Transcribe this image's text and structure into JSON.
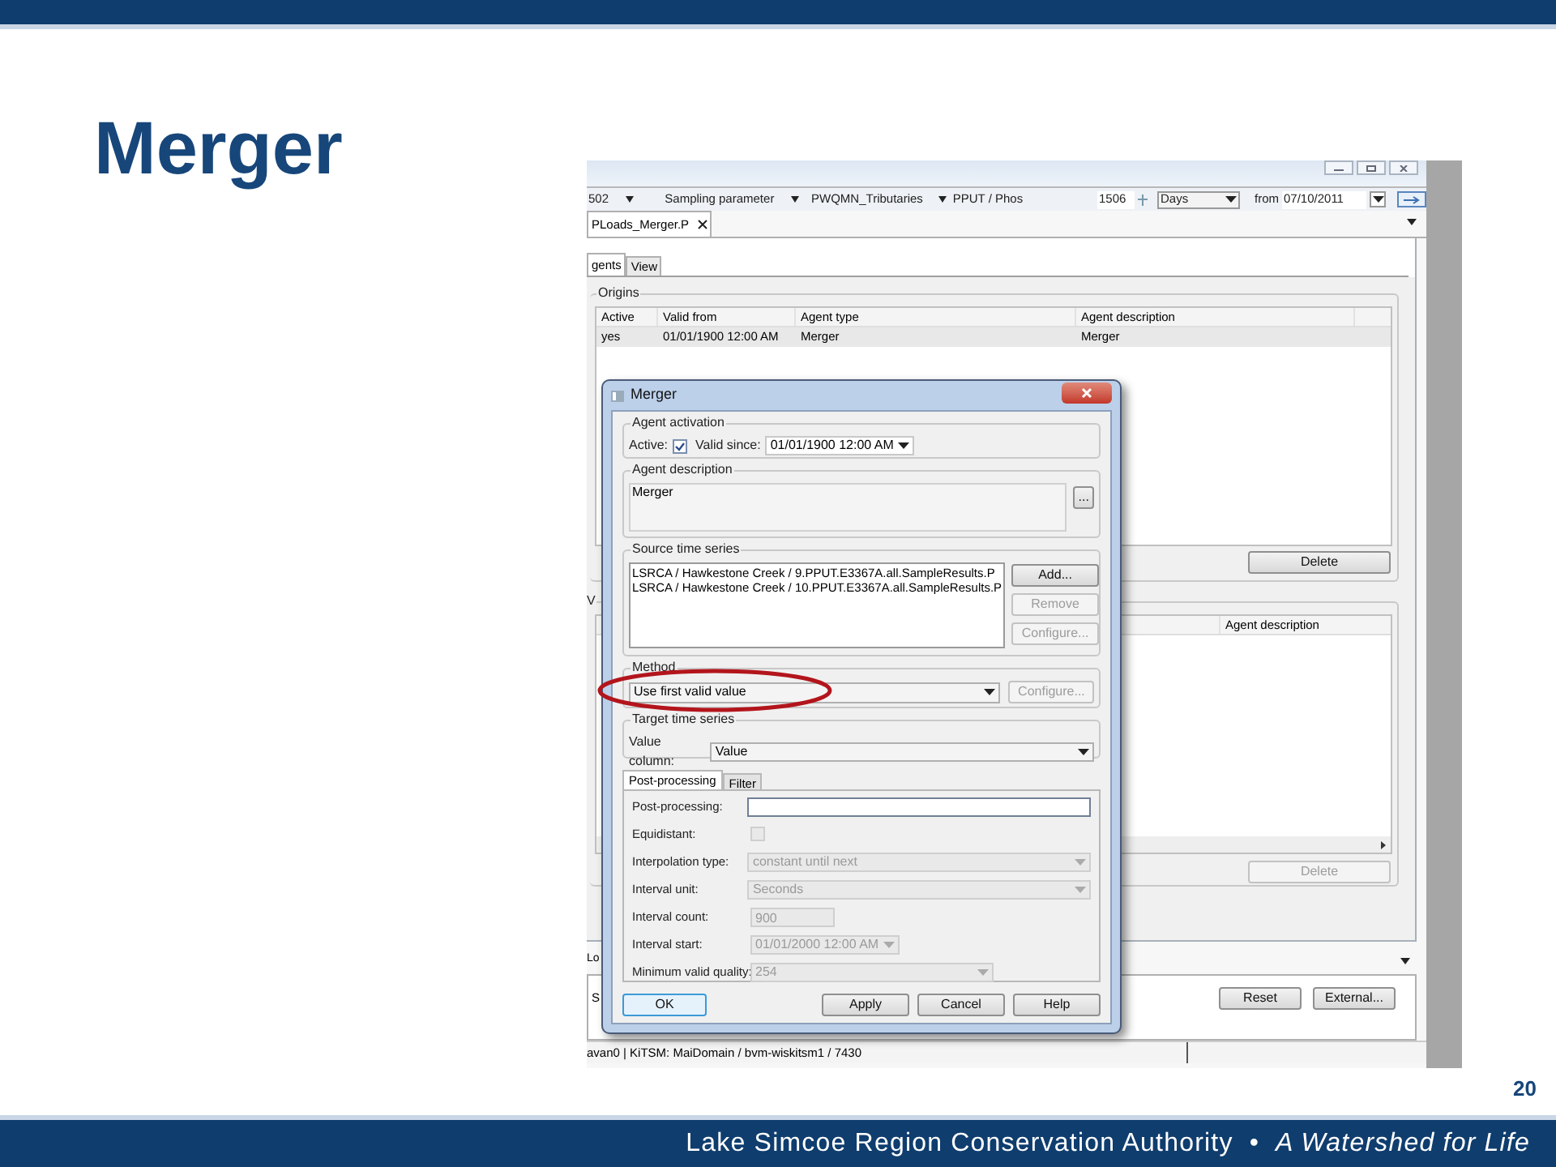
{
  "slide": {
    "title": "Merger",
    "page_number": "20",
    "footer": {
      "organization": "Lake Simcoe Region Conservation Authority",
      "separator": "•",
      "tagline": "A Watershed for Life"
    }
  },
  "app": {
    "toolbar": {
      "items": [
        {
          "label": "502",
          "dropdown": true
        },
        {
          "label": "Sampling parameter",
          "dropdown": true
        },
        {
          "label": "PWQMN_Tributaries",
          "dropdown": true
        },
        {
          "label": "PPUT / Phos",
          "dropdown": false
        }
      ],
      "count": "1506",
      "unit": "Days",
      "from_label": "from",
      "from_date": "07/10/2011"
    },
    "document_tab": {
      "label": "PLoads_Merger.P"
    },
    "subtabs": [
      {
        "label": "gents",
        "selected": true
      },
      {
        "label": "View",
        "selected": false
      }
    ],
    "origins": {
      "title": "Origins",
      "columns": [
        "Active",
        "Valid from",
        "Agent type",
        "Agent description"
      ],
      "rows": [
        {
          "cells": [
            "yes",
            "01/01/1900 12:00 AM",
            "Merger",
            "Merger"
          ],
          "selected": true
        }
      ],
      "delete_button": {
        "label": "Delete",
        "disabled": false
      }
    },
    "second_group": {
      "title": "V",
      "columns": [
        "Agent description"
      ],
      "delete_button": {
        "label": "Delete",
        "disabled": true
      }
    },
    "bottom": {
      "panel_label": "Lo",
      "side_label": "S",
      "buttons": [
        "Reset",
        "External..."
      ]
    },
    "status_bar": "avan0 | KiTSM: MaiDomain / bvm-wiskitsm1 / 7430"
  },
  "dialog": {
    "title": "Merger",
    "agent_activation": {
      "title": "Agent activation",
      "active_label": "Active:",
      "active_checked": true,
      "valid_since_label": "Valid since:",
      "valid_since": "01/01/1900 12:00 AM"
    },
    "agent_description": {
      "title": "Agent description",
      "value": "Merger",
      "more_button": "..."
    },
    "source": {
      "title": "Source time series",
      "items": [
        "LSRCA / Hawkestone Creek / 9.PPUT.E3367A.all.SampleResults.P",
        "LSRCA / Hawkestone Creek / 10.PPUT.E3367A.all.SampleResults.P"
      ],
      "buttons": [
        {
          "label": "Add...",
          "disabled": false
        },
        {
          "label": "Remove",
          "disabled": true
        },
        {
          "label": "Configure...",
          "disabled": true
        }
      ]
    },
    "method": {
      "title": "Method",
      "value": "Use first valid value",
      "configure": {
        "label": "Configure...",
        "disabled": true
      }
    },
    "target": {
      "title": "Target time series",
      "value_column_label": "Value column:",
      "value": "Value"
    },
    "tabs": [
      {
        "label": "Post-processing",
        "selected": true
      },
      {
        "label": "Filter",
        "selected": false
      }
    ],
    "fields": [
      {
        "label": "Post-processing:",
        "kind": "text",
        "disabled": false
      },
      {
        "label": "Equidistant:",
        "kind": "checkbox",
        "checked": false,
        "disabled": true
      },
      {
        "label": "Interpolation type:",
        "kind": "select",
        "value": "constant until next",
        "disabled": true
      },
      {
        "label": "Interval unit:",
        "kind": "select",
        "value": "Seconds",
        "disabled": true
      },
      {
        "label": "Interval count:",
        "kind": "number",
        "value": "900",
        "disabled": true
      },
      {
        "label": "Interval start:",
        "kind": "datetime",
        "value": "01/01/2000 12:00 AM",
        "disabled": true
      },
      {
        "label": "Minimum valid quality:",
        "kind": "select",
        "value": "254",
        "disabled": true
      }
    ],
    "buttons": [
      {
        "label": "OK",
        "default": true
      },
      {
        "label": "Apply",
        "default": false
      },
      {
        "label": "Cancel",
        "default": false
      },
      {
        "label": "Help",
        "default": false
      }
    ]
  }
}
